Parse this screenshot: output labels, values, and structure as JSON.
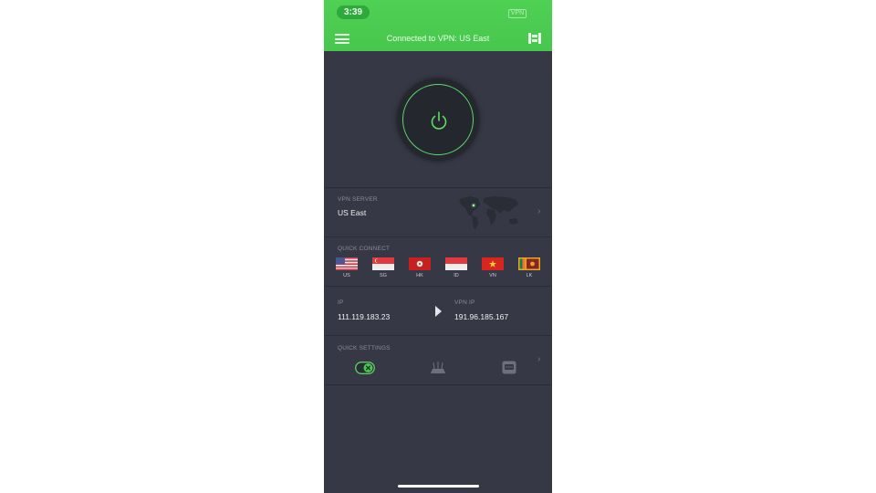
{
  "status_bar": {
    "time": "3:39",
    "vpn_badge": "VPN"
  },
  "header": {
    "title": "Connected to VPN: US East",
    "menu_icon": "hamburger-menu-icon",
    "right_icon": "server-list-icon"
  },
  "power_button": {
    "icon": "power-icon",
    "state": "connected",
    "accent_color": "#5fdc66"
  },
  "annotation": {
    "icon": "red-arrow-icon",
    "color": "#e8321e"
  },
  "vpn_server": {
    "label": "VPN SERVER",
    "value": "US East",
    "map_icon": "world-map-icon"
  },
  "quick_connect": {
    "label": "QUICK CONNECT",
    "countries": [
      {
        "code": "US",
        "flag": "us-flag-icon"
      },
      {
        "code": "SG",
        "flag": "sg-flag-icon"
      },
      {
        "code": "HK",
        "flag": "hk-flag-icon"
      },
      {
        "code": "ID",
        "flag": "id-flag-icon"
      },
      {
        "code": "VN",
        "flag": "vn-flag-icon"
      },
      {
        "code": "LK",
        "flag": "lk-flag-icon"
      }
    ]
  },
  "ip_info": {
    "ip_label": "IP",
    "ip_value": "111.119.183.23",
    "vpn_ip_label": "VPN IP",
    "vpn_ip_value": "191.96.185.167"
  },
  "quick_settings": {
    "label": "QUICK SETTINGS",
    "items": [
      {
        "name": "kill-switch-toggle",
        "icon": "toggle-x-icon",
        "active": true
      },
      {
        "name": "router",
        "icon": "router-icon",
        "active": false
      },
      {
        "name": "ad-blocker",
        "icon": "browser-window-icon",
        "active": false
      }
    ]
  },
  "colors": {
    "header_green": "#4fd154",
    "background": "#363845",
    "accent_green": "#5fdc66"
  }
}
